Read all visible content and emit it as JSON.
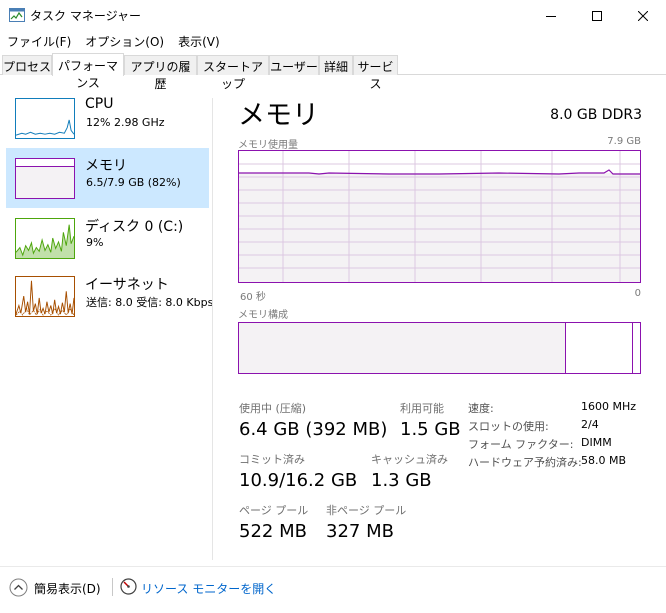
{
  "window": {
    "title": "タスク マネージャー"
  },
  "menu": [
    "ファイル(F)",
    "オプション(O)",
    "表示(V)"
  ],
  "tabs": [
    {
      "label": "プロセス",
      "active": false
    },
    {
      "label": "パフォーマンス",
      "active": true
    },
    {
      "label": "アプリの履歴",
      "active": false
    },
    {
      "label": "スタートアップ",
      "active": false
    },
    {
      "label": "ユーザー",
      "active": false
    },
    {
      "label": "詳細",
      "active": false
    },
    {
      "label": "サービス",
      "active": false
    }
  ],
  "sidebar": {
    "items": [
      {
        "title": "CPU",
        "sub": "12%  2.98 GHz",
        "color": "#117dbb",
        "selected": false
      },
      {
        "title": "メモリ",
        "sub": "6.5/7.9 GB (82%)",
        "color": "#8b12ae",
        "selected": true
      },
      {
        "title": "ディスク 0 (C:)",
        "sub": "9%",
        "color": "#4da60c",
        "selected": false
      },
      {
        "title": "イーサネット",
        "sub": "送信: 8.0  受信: 8.0 Kbps",
        "color": "#a74f01",
        "selected": false
      }
    ]
  },
  "main": {
    "title": "メモリ",
    "spec": "8.0 GB DDR3",
    "usage_graph": {
      "label": "メモリ使用量",
      "max_label": "7.9 GB",
      "x_left": "60 秒",
      "x_right": "0",
      "usage_fraction": 0.82
    },
    "composition": {
      "label": "メモリ構成"
    },
    "stats": {
      "in_use_label": "使用中 (圧縮)",
      "in_use_value": "6.4 GB (392 MB)",
      "available_label": "利用可能",
      "available_value": "1.5 GB",
      "committed_label": "コミット済み",
      "committed_value": "10.9/16.2 GB",
      "cached_label": "キャッシュ済み",
      "cached_value": "1.3 GB",
      "paged_label": "ページ プール",
      "paged_value": "522 MB",
      "nonpaged_label": "非ページ プール",
      "nonpaged_value": "327 MB"
    },
    "info": [
      {
        "label": "速度:",
        "value": "1600 MHz"
      },
      {
        "label": "スロットの使用:",
        "value": "2/4"
      },
      {
        "label": "フォーム ファクター:",
        "value": "DIMM"
      },
      {
        "label": "ハードウェア予約済み:",
        "value": "58.0 MB"
      }
    ]
  },
  "footer": {
    "fewer_details": "簡易表示(D)",
    "resource_monitor": "リソース モニターを開く"
  },
  "colors": {
    "memory": "#8b12ae",
    "cpu": "#117dbb",
    "disk": "#4da60c",
    "ethernet": "#a74f01",
    "selected_bg": "#cce8ff",
    "link": "#0066cc"
  }
}
